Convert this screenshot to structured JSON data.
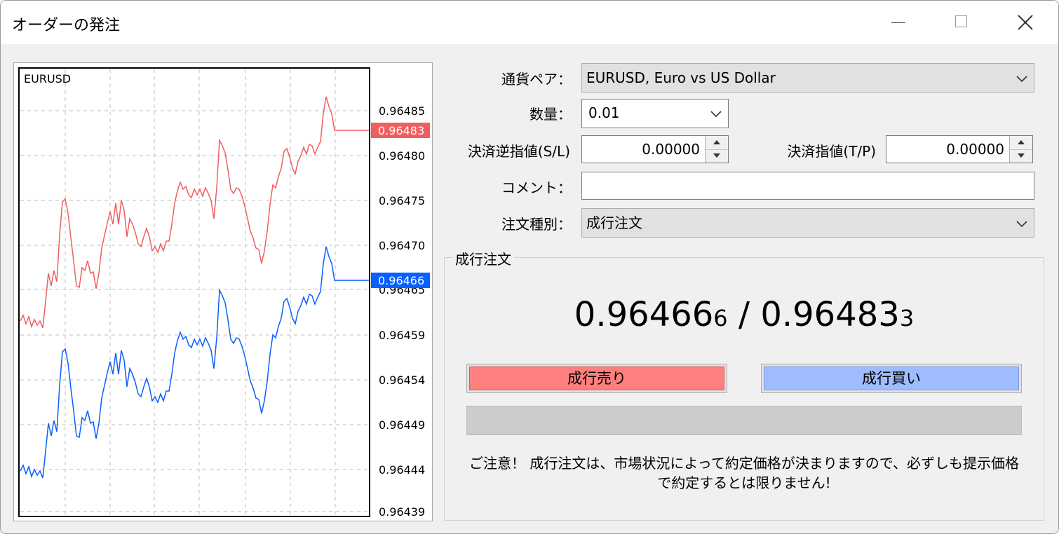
{
  "window": {
    "title": "オーダーの発注"
  },
  "chart": {
    "symbol": "EURUSD",
    "y_axis_labels": [
      "0.96485",
      "0.96480",
      "0.96475",
      "0.96470",
      "0.96465",
      "0.96459",
      "0.96454",
      "0.96449",
      "0.96444",
      "0.96439"
    ],
    "ask_tag": "0.96483",
    "bid_tag": "0.96466",
    "ask_color": "#f05f5f",
    "bid_color": "#0a5fff"
  },
  "form": {
    "symbol_label": "通貨ペア：",
    "symbol_value": "EURUSD, Euro vs US Dollar",
    "volume_label": "数量：",
    "volume_value": "0.01",
    "sl_label": "決済逆指値(S/L)",
    "sl_value": "0.00000",
    "tp_label": "決済指値(T/P)",
    "tp_value": "0.00000",
    "comment_label": "コメント：",
    "comment_value": "",
    "type_label": "注文種別：",
    "type_value": "成行注文"
  },
  "market": {
    "group_title": "成行注文",
    "bid_main": "0.96466",
    "bid_small": "6",
    "separator": " / ",
    "ask_main": "0.96483",
    "ask_small": "3",
    "sell_label": "成行売り",
    "buy_label": "成行買い",
    "sell_color": "#ff7f7f",
    "buy_color": "#9fbcff",
    "notice": "ご注意！ 成行注文は、市場状況によって約定価格が決まりますので、必ずしも提示価格で約定するとは限りません!"
  }
}
